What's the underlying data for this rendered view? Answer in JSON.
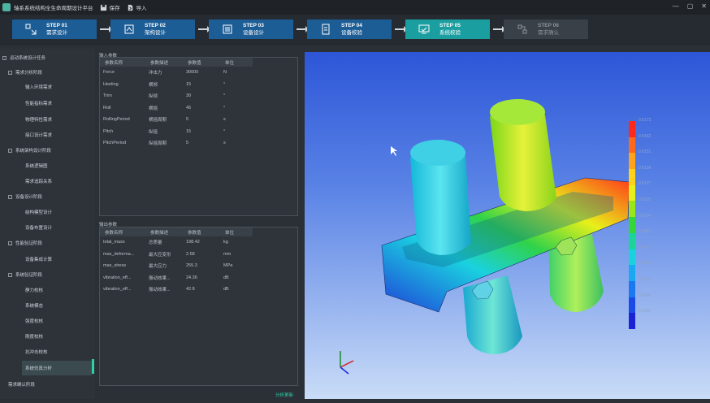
{
  "app": {
    "title": "轴系系统结构全生命周期设计平台",
    "save_label": "保存",
    "import_label": "导入"
  },
  "window": {
    "minimize": "—",
    "maximize": "▢",
    "close": "✕"
  },
  "steps": [
    {
      "num": "STEP 01",
      "label": "需求设计",
      "state": "done"
    },
    {
      "num": "STEP 02",
      "label": "架构设计",
      "state": "done"
    },
    {
      "num": "STEP 03",
      "label": "设备设计",
      "state": "done"
    },
    {
      "num": "STEP 04",
      "label": "设备校验",
      "state": "done"
    },
    {
      "num": "STEP 05",
      "label": "系统校验",
      "state": "active"
    },
    {
      "num": "STEP 06",
      "label": "需求确认",
      "state": "pending"
    }
  ],
  "sidebar": {
    "items": [
      {
        "label": "运动系统设计任务",
        "level": 0
      },
      {
        "label": "需求分析阶段",
        "level": 1
      },
      {
        "label": "输入环境需求",
        "level": 2
      },
      {
        "label": "性能指标需求",
        "level": 2
      },
      {
        "label": "物理特性需求",
        "level": 2
      },
      {
        "label": "接口设计需求",
        "level": 2
      },
      {
        "label": "系统架构设计阶段",
        "level": 1
      },
      {
        "label": "系统逻辑图",
        "level": 2
      },
      {
        "label": "需求追踪关系",
        "level": 2
      },
      {
        "label": "设备设计阶段",
        "level": 1
      },
      {
        "label": "结构模型设计",
        "level": 2
      },
      {
        "label": "设备布置设计",
        "level": 2
      },
      {
        "label": "性能验证阶段",
        "level": 1
      },
      {
        "label": "设备集成计算",
        "level": 2
      },
      {
        "label": "系统验证阶段",
        "level": 1
      },
      {
        "label": "静力校核",
        "level": 2
      },
      {
        "label": "系统模态",
        "level": 2
      },
      {
        "label": "强度校核",
        "level": 2
      },
      {
        "label": "刚度校核",
        "level": 2
      },
      {
        "label": "抗冲击校核",
        "level": 2
      },
      {
        "label": "系统仿真分析",
        "level": 2,
        "selected": true
      },
      {
        "label": "需求确认阶段",
        "level": 1
      }
    ]
  },
  "input_panel": {
    "label": "输入参数",
    "headers": [
      "参数名称",
      "参数描述",
      "参数值",
      "单位"
    ],
    "rows": [
      [
        "Force",
        "冲击力",
        "30000",
        "N"
      ],
      [
        "Heeling",
        "横倾",
        "15",
        "°"
      ],
      [
        "Trim",
        "纵倾",
        "30",
        "°"
      ],
      [
        "Roll",
        "横摇",
        "45",
        "°"
      ],
      [
        "RollingPeriod",
        "横摇周期",
        "5",
        "s"
      ],
      [
        "Pitch",
        "纵摇",
        "15",
        "°"
      ],
      [
        "PitchPeriod",
        "纵摇周期",
        "5",
        "s"
      ]
    ]
  },
  "output_panel": {
    "label": "输出参数",
    "headers": [
      "参数名称",
      "参数描述",
      "参数值",
      "单位"
    ],
    "rows": [
      [
        "total_mass",
        "总质量",
        "198.42",
        "kg"
      ],
      [
        "max_deforma...",
        "最大应变形",
        "2.58",
        "mm"
      ],
      [
        "max_stress",
        "最大应力",
        "255.3",
        "MPa"
      ],
      [
        "vibration_eff...",
        "振动效果...",
        "24.36",
        "dB"
      ],
      [
        "vibration_eff...",
        "振动效果...",
        "42.8",
        "dB"
      ]
    ]
  },
  "link_label": "分析更新",
  "legend": {
    "labels": [
      "0.0173",
      "0.0162",
      "0.0151",
      "0.0139",
      "0.0127",
      "0.0115",
      "0.0104",
      "0.0092",
      "0.0081",
      "0.0069",
      "0.0058",
      "0.0046",
      "0.0035"
    ],
    "colors": [
      "#ff2a1a",
      "#ff6a1a",
      "#ffa31a",
      "#ffd21a",
      "#e8f01a",
      "#9be61a",
      "#34d63a",
      "#1ad49a",
      "#1ad1e0",
      "#1aa8f0",
      "#1a78f0",
      "#1a4be6",
      "#1a22d6"
    ]
  }
}
